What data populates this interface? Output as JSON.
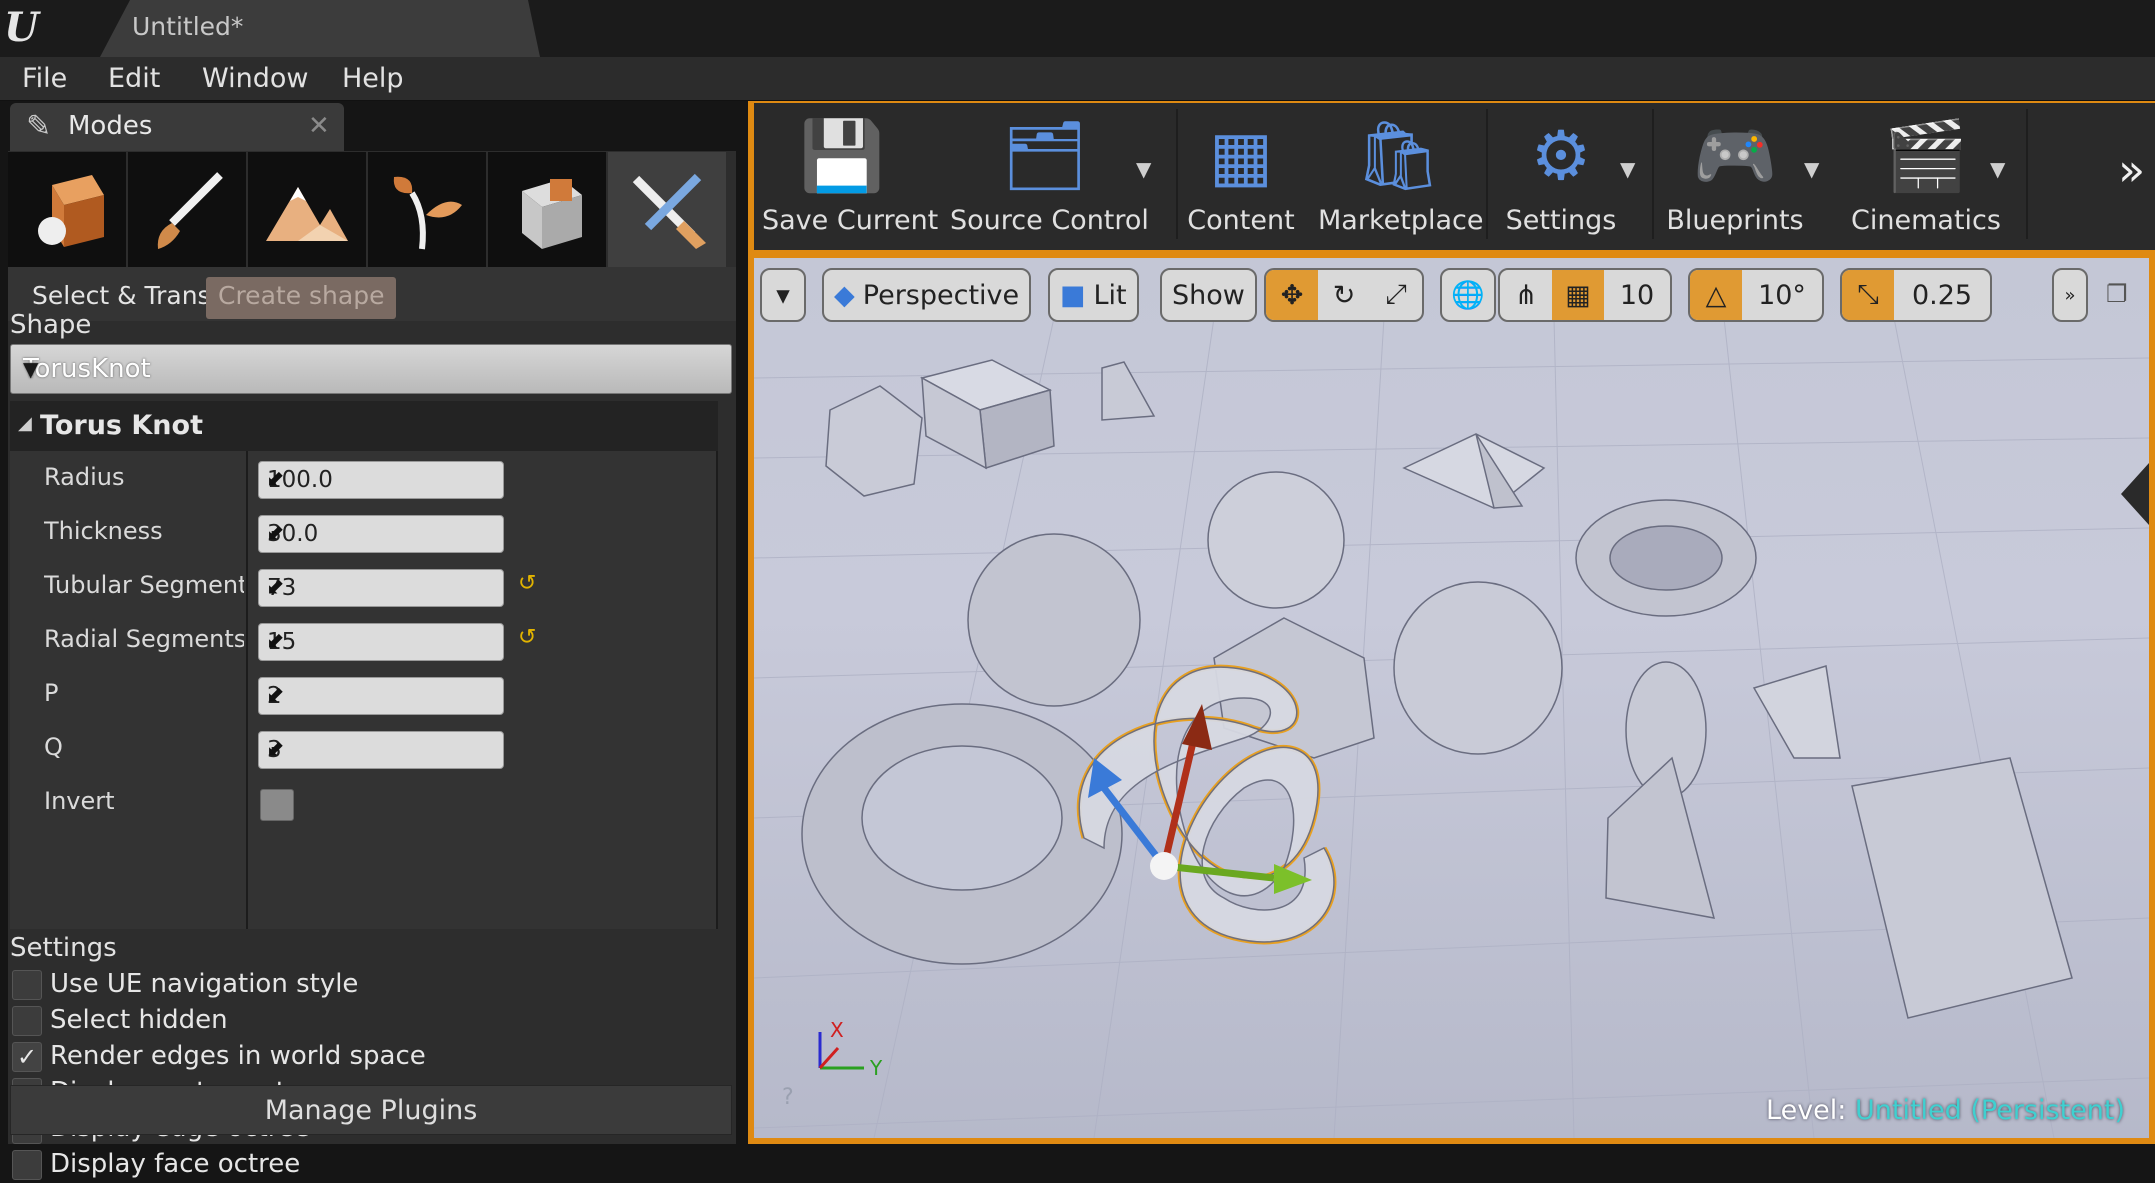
{
  "window": {
    "logo": "U",
    "document_title": "Untitled*"
  },
  "menu": [
    "File",
    "Edit",
    "Window",
    "Help"
  ],
  "modes_panel": {
    "tab_label": "Modes",
    "mode_buttons": [
      "place-mode",
      "paint-mode",
      "landscape-mode",
      "foliage-mode",
      "geometry-mode",
      "mesh-tool-mode"
    ],
    "subtabs": [
      "Select & Transform",
      "Create shape"
    ],
    "shape_label": "Shape",
    "shape_value": "TorusKnot",
    "category_title": "Torus Knot",
    "properties": [
      {
        "label": "Radius",
        "value": "100.0",
        "reset": false
      },
      {
        "label": "Thickness",
        "value": "30.0",
        "reset": false
      },
      {
        "label": "Tubular Segments",
        "value": "73",
        "reset": true
      },
      {
        "label": "Radial Segments",
        "value": "15",
        "reset": true
      },
      {
        "label": "P",
        "value": "2",
        "reset": false
      },
      {
        "label": "Q",
        "value": "3",
        "reset": false
      }
    ],
    "invert_label": "Invert",
    "invert_checked": false,
    "settings_label": "Settings",
    "settings": [
      {
        "label": "Use UE navigation style",
        "checked": false
      },
      {
        "label": "Select hidden",
        "checked": false
      },
      {
        "label": "Render edges in world space",
        "checked": true
      },
      {
        "label": "Display vertex octree",
        "checked": false
      },
      {
        "label": "Display edge octree",
        "checked": false
      },
      {
        "label": "Display face octree",
        "checked": false
      }
    ],
    "manage_plugins": "Manage Plugins"
  },
  "toolbar": {
    "buttons": [
      "Save Current",
      "Source Control",
      "Content",
      "Marketplace",
      "Settings",
      "Blueprints",
      "Cinematics"
    ]
  },
  "viewport": {
    "perspective": "Perspective",
    "lit": "Lit",
    "show": "Show",
    "grid_snap": "10",
    "rotation_snap": "10°",
    "scale_snap": "0.25",
    "level_label": "Level:",
    "level_name": "Untitled (Persistent)",
    "axis_x": "X",
    "axis_y": "Y"
  },
  "colors": {
    "accent_orange": "#df8a12",
    "selection": "#e8a020",
    "level_name": "#3fd0d0"
  }
}
